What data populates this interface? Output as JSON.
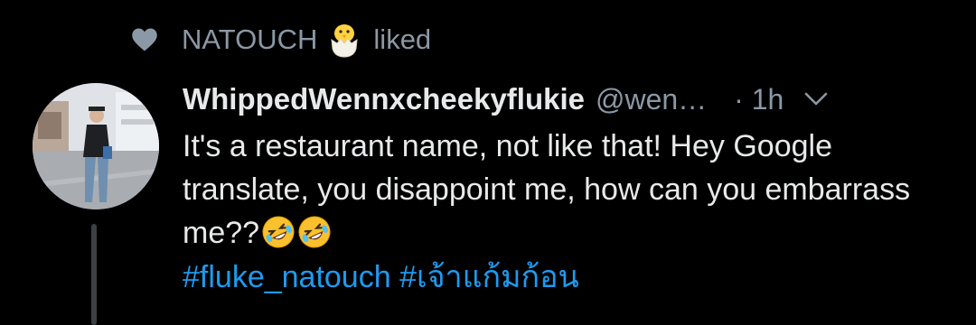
{
  "social_context": {
    "icon": "heart-icon",
    "user": "NATOUCH",
    "user_emoji": "hatching-chick-emoji",
    "action": "liked"
  },
  "tweet": {
    "avatar": "avatar-photo",
    "display_name": "WhippedWennxcheekyflukie",
    "handle": "@wen…",
    "time": "· 1h",
    "menu_icon": "chevron-down-icon",
    "text": "It's a restaurant name, not like that! Hey Google translate, you disappoint me, how can you embarrass me??",
    "text_emojis": [
      "rolling-on-floor-laughing-emoji",
      "rolling-on-floor-laughing-emoji"
    ],
    "hashtags": [
      "#fluke_natouch",
      "#เจ้าแก้มก้อน"
    ]
  },
  "colors": {
    "background": "#000000",
    "primary_text": "#e7e9ea",
    "secondary_text": "#8b98a5",
    "link": "#1d9bf0",
    "thread_line": "#3d4043"
  }
}
